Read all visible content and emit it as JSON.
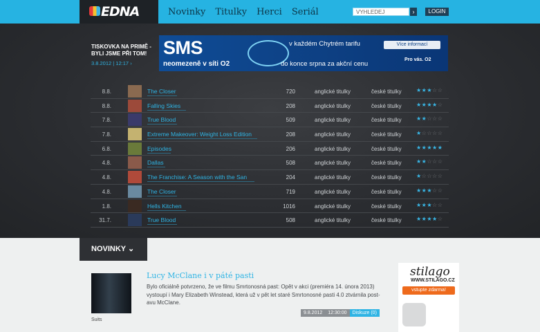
{
  "header": {
    "logo": "EDNA",
    "nav": [
      "Novinky",
      "Titulky",
      "Herci",
      "Seriál"
    ],
    "search_placeholder": "VYHLEDEJ",
    "login": "LOGIN"
  },
  "promo": {
    "title": "TISKOVKA NA PRIMĚ - BYLI JSME PŘI TOM!",
    "date": "3.8.2012 | 12:17"
  },
  "banner": {
    "headline": "SMS",
    "subline": "neomezeně v síti O2",
    "line1": "v každém Chytrém tarifu",
    "line2": "do konce srpna za akční cenu",
    "button": "Více informací",
    "brand": "Pro vás. O2"
  },
  "colors": {
    "accent": "#26b3e2",
    "star_on": "#39b8e8",
    "star_off": "#707478"
  },
  "subtitles": [
    {
      "date": "8.8.",
      "title": "The Closer",
      "count": "720",
      "en": "anglické titulky",
      "cz": "české titulky",
      "rating": 3
    },
    {
      "date": "8.8.",
      "title": "Falling Skies",
      "count": "208",
      "en": "anglické titulky",
      "cz": "české titulky",
      "rating": 4
    },
    {
      "date": "7.8.",
      "title": "True Blood",
      "count": "509",
      "en": "anglické titulky",
      "cz": "české titulky",
      "rating": 2
    },
    {
      "date": "7.8.",
      "title": "Extreme Makeover: Weight Loss Edition",
      "count": "208",
      "en": "anglické titulky",
      "cz": "české titulky",
      "rating": 1
    },
    {
      "date": "6.8.",
      "title": "Episodes",
      "count": "206",
      "en": "anglické titulky",
      "cz": "české titulky",
      "rating": 5
    },
    {
      "date": "4.8.",
      "title": "Dallas",
      "count": "508",
      "en": "anglické titulky",
      "cz": "české titulky",
      "rating": 2
    },
    {
      "date": "4.8.",
      "title": "The Franchise: A Season with the San",
      "count": "204",
      "en": "anglické titulky",
      "cz": "české titulky",
      "rating": 1
    },
    {
      "date": "4.8.",
      "title": "The Closer",
      "count": "719",
      "en": "anglické titulky",
      "cz": "české titulky",
      "rating": 3
    },
    {
      "date": "1.8.",
      "title": "Hells Kitchen",
      "count": "1016",
      "en": "anglické titulky",
      "cz": "české titulky",
      "rating": 3
    },
    {
      "date": "31.7.",
      "title": "True Blood",
      "count": "508",
      "en": "anglické titulky",
      "cz": "české titulky",
      "rating": 4
    }
  ],
  "novinky": {
    "label": "NOVINKY",
    "title": "Lucy McClane i v páté pasti",
    "text": "Bylo oficiálně potvrzeno, že ve filmu Smrtonosná past: Opět v akci (premiéra 14. února 2013) vystoupí i Mary Elizabeth Winstead, která už v pět let staré Smrtonosné pasti 4.0 ztvárnila post-avu McClane.",
    "date": "9.8.2012",
    "time": "12:30:00",
    "discussion": "Diskuze (0)",
    "caption": "Suits"
  },
  "side_ad": {
    "logo": "stilago",
    "url": "WWW.STILAGO.CZ",
    "button": "vstupte zdarma!"
  }
}
